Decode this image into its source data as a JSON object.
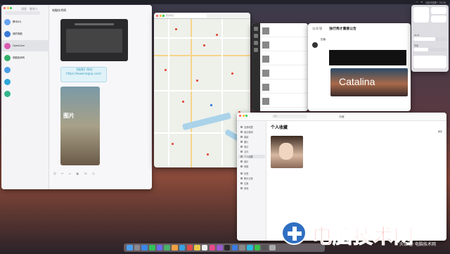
{
  "menubar": {
    "clock": "1月23日周一 22:32"
  },
  "qq": {
    "tabs": [
      "消息",
      "联系人"
    ],
    "conversations": [
      {
        "name": "腾讯QQ",
        "preview": ""
      },
      {
        "name": "我的电脑",
        "preview": ""
      },
      {
        "name": "OpenCore",
        "preview": ""
      },
      {
        "name": "电脑技术网",
        "preview": ""
      },
      {
        "name": "",
        "preview": ""
      },
      {
        "name": "",
        "preview": ""
      },
      {
        "name": "",
        "preview": ""
      }
    ],
    "chat_title": "电脑技术网",
    "link_line1": "【链接】网站",
    "link_line2": "https://www.tagxp.com/",
    "image_caption": "图片"
  },
  "map": {
    "search_placeholder": "搜索地点"
  },
  "wechat_list": {
    "rows": [
      {
        "name": "",
        "date": ""
      },
      {
        "name": "",
        "date": ""
      },
      {
        "name": "",
        "date": ""
      },
      {
        "name": "",
        "date": ""
      },
      {
        "name": "",
        "date": ""
      },
      {
        "name": "",
        "date": ""
      }
    ]
  },
  "article": {
    "account_label": "公众号",
    "title": "独行秀才重要公告",
    "byline": "旧版",
    "banner_text": "",
    "meta_line1": "",
    "meta_line2": "",
    "hero_word": "Catalina",
    "footer": ""
  },
  "control_center": {
    "label_wifi": "Wi-Fi",
    "label_sound": "声音",
    "display_level": 0.65,
    "sound_level": 0.45
  },
  "favorites": {
    "window_title": "收藏",
    "search_placeholder": "搜索",
    "heading": "个人收藏",
    "subheading": "",
    "sort_label": "排序",
    "sidebar": [
      "全部收藏",
      "最近使用",
      "链接",
      "图片",
      "笔记",
      "文件",
      "个人收藏",
      "音乐",
      "视频",
      "标签",
      "聊天记录",
      "位置",
      "其他"
    ]
  },
  "watermark": {
    "text": "电脑技术网",
    "sub": "头条 @ 电脑技术网"
  },
  "colors": {
    "accent": "#e43a2a",
    "link": "#3a9ec0",
    "dock_bg": "#c8c8d2"
  }
}
